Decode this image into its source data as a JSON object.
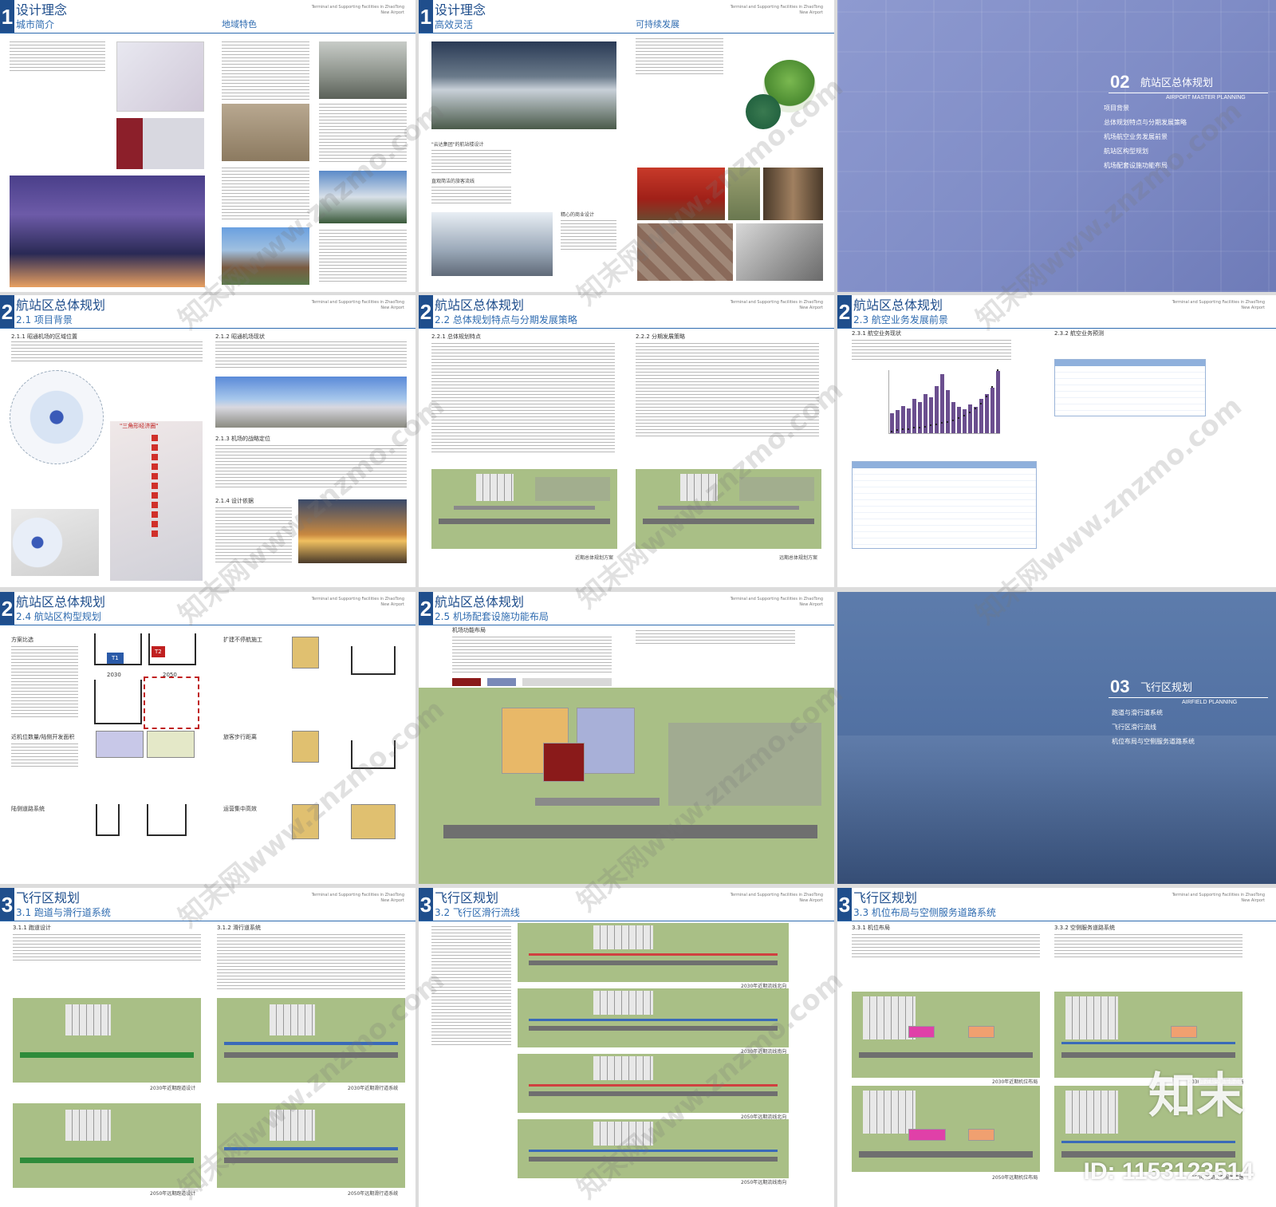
{
  "doc_header": "Terminal and Supporting Facilities in ZhaoTong New Airport",
  "p1": {
    "num": "1",
    "title": "设计理念",
    "subtitle": "城市简介",
    "col_title": "地域特色"
  },
  "p2": {
    "num": "1",
    "title": "设计理念",
    "subtitle": "高效灵活",
    "col_title": "可持续发展",
    "cap1": "\"云达集团\"的航站楼设计",
    "cap2": "直观简洁的旅客流线",
    "cap3": "精心的商业设计"
  },
  "p3": {
    "num": "02",
    "title": "航站区总体规划",
    "en": "AIRPORT MASTER PLANNING",
    "items": [
      "项目背景",
      "总体规划特点与分期发展策略",
      "机场航空业务发展前景",
      "航站区构型规划",
      "机场配套设施功能布局"
    ]
  },
  "p4": {
    "num": "2",
    "title": "航站区总体规划",
    "subtitle": "2.1 项目背景",
    "s1": "2.1.1 昭通机场的区域位置",
    "s2": "2.1.2 昭通机场现状",
    "s3": "2.1.3 机场的战略定位",
    "s4": "2.1.4 设计依据",
    "map_label": "\"三角形经济圈\""
  },
  "p5": {
    "num": "2",
    "title": "航站区总体规划",
    "subtitle": "2.2 总体规划特点与分期发展策略",
    "s1": "2.2.1 总体规划特点",
    "s2": "2.2.2 分期发展策略",
    "cap1": "近期总体规划方案",
    "cap2": "远期总体规划方案"
  },
  "p6": {
    "num": "2",
    "title": "航站区总体规划",
    "subtitle": "2.3 航空业务发展前景",
    "s1": "2.3.1 航空业务现状",
    "s2": "2.3.2 航空业务预测"
  },
  "p7": {
    "num": "2",
    "title": "航站区总体规划",
    "subtitle": "2.4 航站区构型规划",
    "s1": "方案比选",
    "s2": "扩建不停航施工",
    "s3": "近机位数量/陆侧开发面积",
    "s4": "旅客步行距离",
    "s5": "陆侧道路系统",
    "s6": "运营集中高效",
    "y1": "2030",
    "y2": "2050",
    "t1": "T1",
    "t2": "T2"
  },
  "p8": {
    "num": "2",
    "title": "航站区总体规划",
    "subtitle": "2.5 机场配套设施功能布局",
    "s1": "机场功能布局"
  },
  "p9": {
    "num": "03",
    "title": "飞行区规划",
    "en": "AIRFIELD PLANNING",
    "items": [
      "跑道与滑行道系统",
      "飞行区滑行流线",
      "机位布局与空侧服务道路系统"
    ]
  },
  "p10": {
    "num": "3",
    "title": "飞行区规划",
    "subtitle": "3.1 跑道与滑行道系统",
    "s1": "3.1.1 跑道设计",
    "s2": "3.1.2 滑行道系统",
    "cap1": "2030年近期跑道设计",
    "cap2": "2030年近期滑行道系统",
    "cap3": "2050年远期跑道设计",
    "cap4": "2050年远期滑行道系统"
  },
  "p11": {
    "num": "3",
    "title": "飞行区规划",
    "subtitle": "3.2 飞行区滑行流线",
    "cap1": "2030年近期流线北向",
    "cap2": "2030年近期流线南向",
    "cap3": "2050年远期流线北向",
    "cap4": "2050年远期流线南向"
  },
  "p12": {
    "num": "3",
    "title": "飞行区规划",
    "subtitle": "3.3 机位布局与空侧服务道路系统",
    "s1": "3.3.1 机位布局",
    "s2": "3.3.2 空侧服务道路系统",
    "cap1": "2030年近期机位布局",
    "cap2": "2030年近期空侧服务道路",
    "cap3": "2050年远期机位布局",
    "cap4": "2050年远期空侧服务道路"
  },
  "watermark": {
    "site": "知末网www.znzmo.com",
    "logo": "知末",
    "id": "ID: 1153123514"
  },
  "chart_data": {
    "type": "bar",
    "values": [
      30,
      35,
      42,
      38,
      52,
      48,
      60,
      55,
      72,
      90,
      66,
      48,
      40,
      36,
      44,
      40,
      52,
      60,
      70,
      95
    ],
    "line": [
      1,
      2,
      3,
      3,
      4,
      4,
      5,
      6,
      7,
      8,
      9,
      10,
      12,
      14,
      17,
      20,
      24,
      30,
      38,
      52
    ]
  },
  "colors": {
    "accent": "#1f4e8c",
    "cover": "#7f8cc6",
    "plan_green": "#a9bf86"
  }
}
